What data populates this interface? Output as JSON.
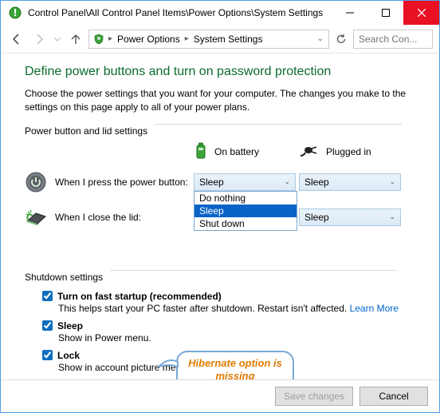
{
  "window": {
    "title": "Control Panel\\All Control Panel Items\\Power Options\\System Settings"
  },
  "breadcrumb": {
    "item1": "Power Options",
    "item2": "System Settings"
  },
  "search": {
    "placeholder": "Search Con..."
  },
  "page": {
    "heading": "Define power buttons and turn on password protection",
    "subtext": "Choose the power settings that you want for your computer. The changes you make to the settings on this page apply to all of your power plans."
  },
  "group": {
    "power_button_lid": "Power button and lid settings",
    "shutdown": "Shutdown settings"
  },
  "cols": {
    "on_battery": "On battery",
    "plugged_in": "Plugged in"
  },
  "rows": {
    "power_button": "When I press the power button:",
    "close_lid": "When I close the lid:"
  },
  "selects": {
    "power_button_battery": "Sleep",
    "power_button_plugged": "Sleep",
    "lid_plugged": "Sleep"
  },
  "dropdown_options": {
    "opt0": "Do nothing",
    "opt1": "Sleep",
    "opt2": "Shut down"
  },
  "shutdown_items": {
    "fast_startup_label": "Turn on fast startup (recommended)",
    "fast_startup_desc": "This helps start your PC faster after shutdown. Restart isn't affected. ",
    "learn_more": "Learn More",
    "sleep_label": "Sleep",
    "sleep_desc": "Show in Power menu.",
    "lock_label": "Lock",
    "lock_desc": "Show in account picture menu."
  },
  "callout": {
    "text": "Hibernate option is missing"
  },
  "footer": {
    "save": "Save changes",
    "cancel": "Cancel"
  }
}
